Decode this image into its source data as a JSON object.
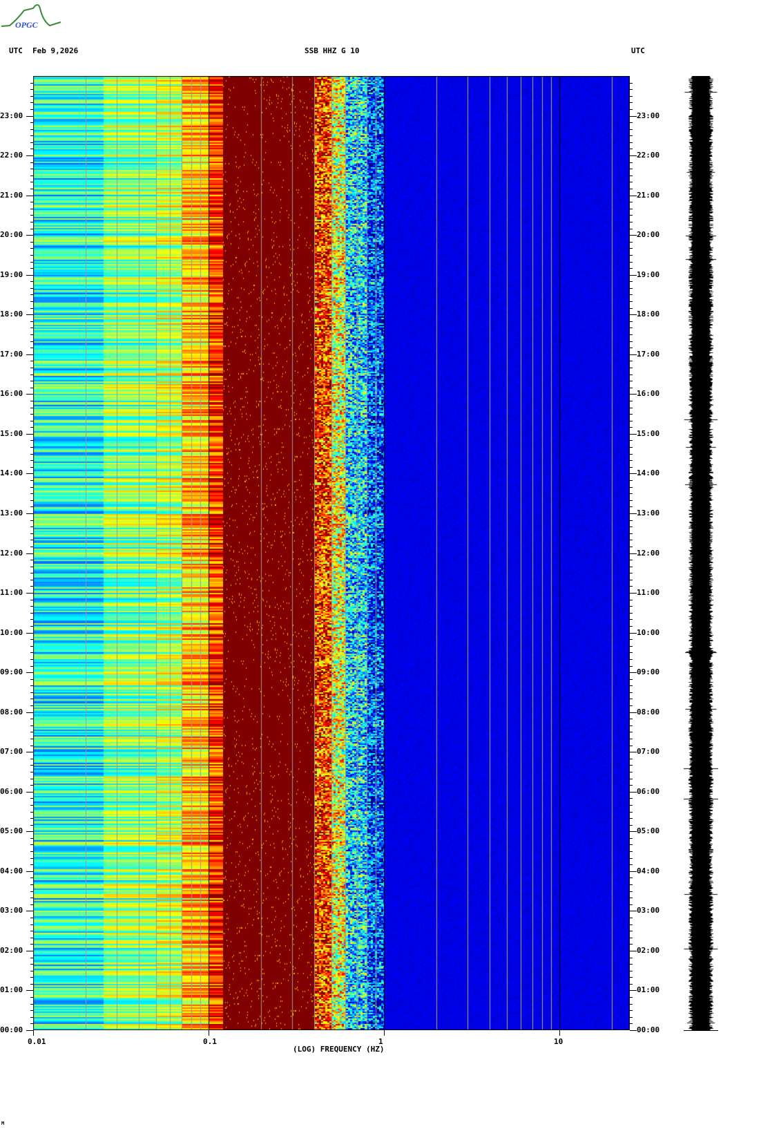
{
  "header": {
    "logo_text": "OPGC",
    "left_tz": "UTC",
    "date": "Feb 9,2026",
    "station": "SSB HHZ G 10",
    "right_tz": "UTC"
  },
  "chart_data": {
    "type": "heatmap",
    "title": "SSB HHZ G 10",
    "xlabel": "(LOG) FREQUENCY (HZ)",
    "xscale": "log",
    "xlim": [
      0.01,
      25
    ],
    "x_ticks": [
      "0.01",
      "0.1",
      "1",
      "10"
    ],
    "x_tick_values": [
      0.01,
      0.1,
      1,
      10
    ],
    "ylim_hours": [
      0,
      24
    ],
    "y_ticks": [
      "00:00",
      "01:00",
      "02:00",
      "03:00",
      "04:00",
      "05:00",
      "06:00",
      "07:00",
      "08:00",
      "09:00",
      "10:00",
      "11:00",
      "12:00",
      "13:00",
      "14:00",
      "15:00",
      "16:00",
      "17:00",
      "18:00",
      "19:00",
      "20:00",
      "21:00",
      "22:00",
      "23:00"
    ],
    "colormap": "jet",
    "relative_power_profile": [
      {
        "f": [
          0.01,
          0.025
        ],
        "level": 0.4
      },
      {
        "f": [
          0.025,
          0.05
        ],
        "level": 0.5
      },
      {
        "f": [
          0.05,
          0.07
        ],
        "level": 0.55
      },
      {
        "f": [
          0.07,
          0.1
        ],
        "level": 0.68
      },
      {
        "f": [
          0.1,
          0.12
        ],
        "level": 0.82
      },
      {
        "f": [
          0.12,
          0.4
        ],
        "level": 1.0
      },
      {
        "f": [
          0.4,
          0.5
        ],
        "level": 0.82
      },
      {
        "f": [
          0.5,
          0.6
        ],
        "level": 0.6
      },
      {
        "f": [
          0.6,
          0.8
        ],
        "level": 0.35
      },
      {
        "f": [
          0.8,
          1.0
        ],
        "level": 0.2
      },
      {
        "f": [
          1.0,
          25
        ],
        "level": 0.1
      }
    ]
  },
  "footer": {
    "mark": "M"
  }
}
